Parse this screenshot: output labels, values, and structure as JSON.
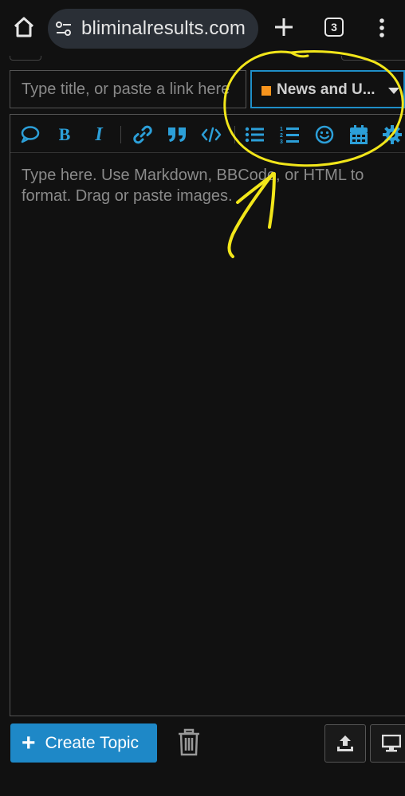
{
  "browser": {
    "url": "bliminalresults.com",
    "tab_count": "3",
    "home_icon": "home-icon",
    "site_info_icon": "tune-icon",
    "new_tab_icon": "plus-icon",
    "menu_icon": "kebab-menu-icon"
  },
  "composer": {
    "title_placeholder": "Type title, or paste a link here",
    "category": {
      "label": "News and U...",
      "color": "#f7941d"
    },
    "toolbar": {
      "items": [
        "quote-bubble-icon",
        "bold-icon",
        "italic-icon",
        "link-icon",
        "blockquote-icon",
        "code-icon",
        "bullet-list-icon",
        "numbered-list-icon",
        "emoji-icon",
        "calendar-icon",
        "gear-icon"
      ],
      "bold_label": "B",
      "italic_label": "I"
    },
    "body_placeholder": "Type here. Use Markdown, BBCode, or HTML to format. Drag or paste images."
  },
  "footer": {
    "create_label": "Create Topic",
    "create_color": "#1e88c7"
  },
  "colors": {
    "accent": "#2c9fd8",
    "annotation": "#f2e61a",
    "background": "#111111"
  }
}
